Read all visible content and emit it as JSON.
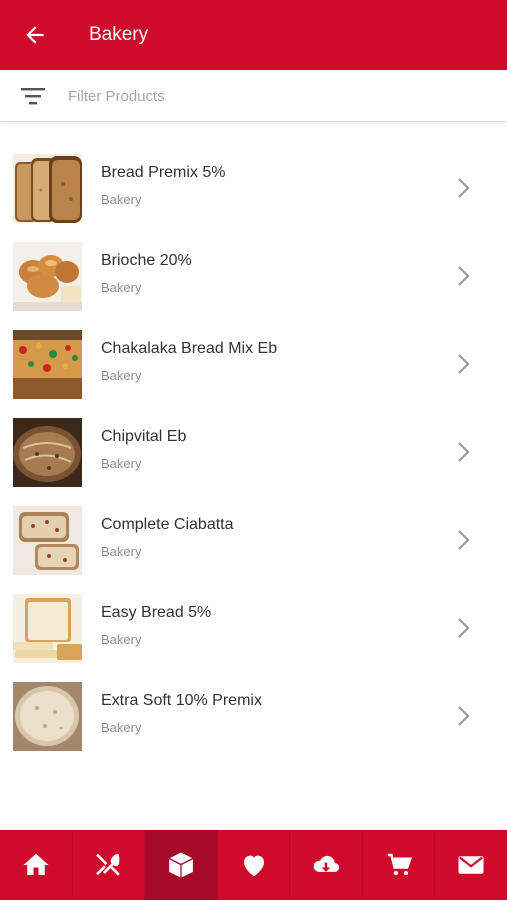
{
  "header": {
    "title": "Bakery",
    "background": "#d00a2c"
  },
  "filter": {
    "placeholder": "Filter Products",
    "value": ""
  },
  "products": [
    {
      "name": "Bread Premix 5%",
      "category": "Bakery",
      "thumb_icon": "sliced-bread-image"
    },
    {
      "name": "Brioche 20%",
      "category": "Bakery",
      "thumb_icon": "brioche-image"
    },
    {
      "name": "Chakalaka Bread Mix Eb",
      "category": "Bakery",
      "thumb_icon": "chakalaka-bread-image"
    },
    {
      "name": "Chipvital Eb",
      "category": "Bakery",
      "thumb_icon": "rustic-loaf-image"
    },
    {
      "name": "Complete Ciabatta",
      "category": "Bakery",
      "thumb_icon": "ciabatta-image"
    },
    {
      "name": "Easy Bread 5%",
      "category": "Bakery",
      "thumb_icon": "white-loaf-image"
    },
    {
      "name": "Extra Soft 10% Premix",
      "category": "Bakery",
      "thumb_icon": "flatbread-image"
    }
  ],
  "bottom_nav": {
    "items": [
      {
        "icon": "home-icon",
        "active": false
      },
      {
        "icon": "fork-knife-icon",
        "active": false
      },
      {
        "icon": "box-icon",
        "active": true
      },
      {
        "icon": "heart-icon",
        "active": false
      },
      {
        "icon": "cloud-download-icon",
        "active": false
      },
      {
        "icon": "cart-icon",
        "active": false
      },
      {
        "icon": "mail-icon",
        "active": false
      }
    ]
  }
}
